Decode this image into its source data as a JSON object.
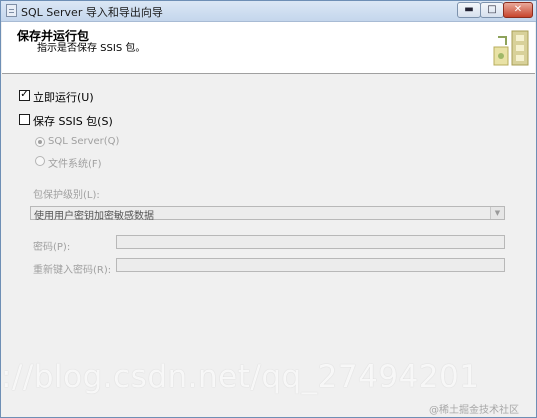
{
  "window": {
    "title": "SQL Server 导入和导出向导",
    "controls": {
      "minimize": "▬",
      "maximize": "□",
      "close": "✕"
    }
  },
  "header": {
    "title": "保存并运行包",
    "subtitle": "指示是否保存 SSIS 包。",
    "icon": "package-icon"
  },
  "options": {
    "run_immediately": {
      "label": "立即运行(U)",
      "checked": true
    },
    "save_package": {
      "label": "保存 SSIS 包(S)",
      "checked": false
    },
    "sql_server": {
      "label": "SQL Server(Q)",
      "selected": true,
      "enabled": false
    },
    "file_system": {
      "label": "文件系统(F)",
      "selected": false,
      "enabled": false
    }
  },
  "protection": {
    "label": "包保护级别(L):",
    "value": "使用用户密钥加密敏感数据"
  },
  "password": {
    "label": "密码(P):",
    "value": ""
  },
  "confirm_password": {
    "label": "重新键入密码(R):",
    "value": ""
  },
  "watermark": {
    "url": "://blog.csdn.net/qq_27494201",
    "credit": "@稀土掘金技术社区"
  }
}
